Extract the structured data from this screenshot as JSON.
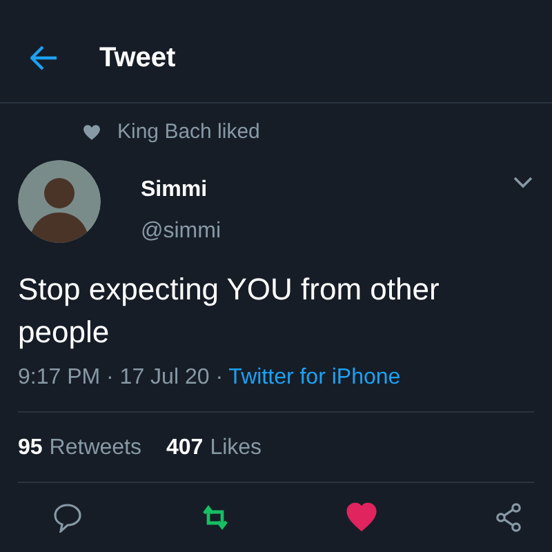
{
  "header": {
    "title": "Tweet"
  },
  "social_context": {
    "text": "King Bach liked"
  },
  "author": {
    "name": "Simmi",
    "handle": "@simmi"
  },
  "tweet": {
    "text": "Stop expecting YOU from other people",
    "time": "9:17 PM · 17 Jul 20 · ",
    "source": "Twitter for iPhone"
  },
  "stats": [
    {
      "count": "95",
      "label": "Retweets"
    },
    {
      "count": "407",
      "label": "Likes"
    }
  ],
  "actions": [
    {
      "kind": "reply",
      "active": false
    },
    {
      "kind": "retweet",
      "active": true
    },
    {
      "kind": "like",
      "active": true
    },
    {
      "kind": "share",
      "active": false
    }
  ]
}
